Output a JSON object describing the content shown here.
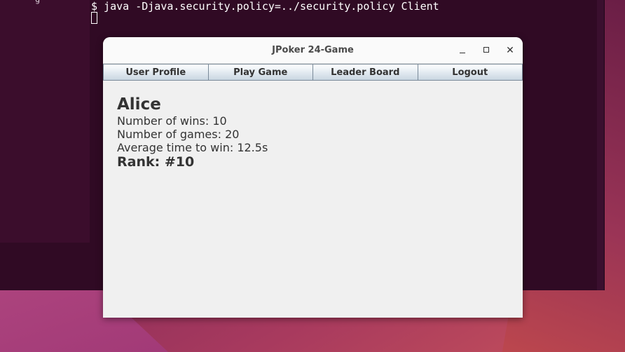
{
  "terminal": {
    "command_line": "$ java -Djava.security.policy=../security.policy Client",
    "partial_glyph": "g"
  },
  "window": {
    "title": "JPoker 24-Game"
  },
  "tabs": [
    {
      "label": "User Profile"
    },
    {
      "label": "Play Game"
    },
    {
      "label": "Leader Board"
    },
    {
      "label": "Logout"
    }
  ],
  "profile": {
    "name": "Alice",
    "wins_line": "Number of wins: 10",
    "games_line": "Number of games: 20",
    "avg_time_line": "Average time to win: 12.5s",
    "rank_line": "Rank: #10"
  },
  "icons": {
    "minimize": "minimize-icon",
    "maximize": "maximize-icon",
    "close": "close-icon"
  }
}
